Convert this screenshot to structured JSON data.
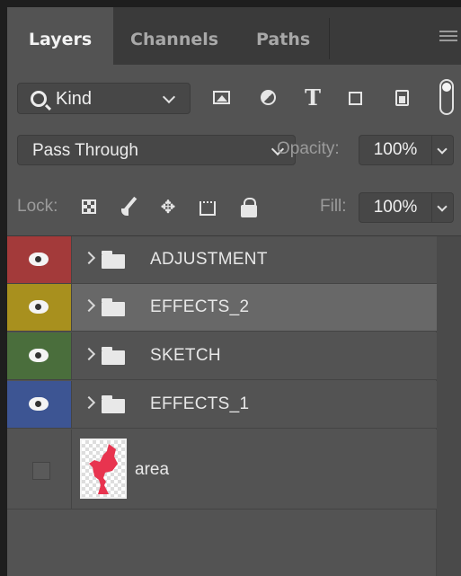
{
  "tabs": {
    "layers": "Layers",
    "channels": "Channels",
    "paths": "Paths"
  },
  "filter": {
    "kind_label": "Kind",
    "icons": [
      "image-filter-icon",
      "adjustment-filter-icon",
      "type-filter-icon",
      "shape-filter-icon",
      "smart-object-filter-icon"
    ],
    "type_glyph": "T"
  },
  "blend": {
    "mode": "Pass Through",
    "opacity_label": "Opacity:",
    "opacity_value": "100%"
  },
  "lock": {
    "label": "Lock:",
    "fill_label": "Fill:",
    "fill_value": "100%",
    "move_glyph": "✥"
  },
  "layers": [
    {
      "name": "ADJUSTMENT",
      "label_color": "#a33a3a",
      "visible": true,
      "type": "group",
      "selected": false
    },
    {
      "name": "EFFECTS_2",
      "label_color": "#a8901e",
      "visible": true,
      "type": "group",
      "selected": true
    },
    {
      "name": "SKETCH",
      "label_color": "#4a6e3c",
      "visible": true,
      "type": "group",
      "selected": false
    },
    {
      "name": "EFFECTS_1",
      "label_color": "#3d5593",
      "visible": true,
      "type": "group",
      "selected": false
    },
    {
      "name": "area",
      "label_color": "",
      "visible": false,
      "type": "pixel",
      "selected": false
    }
  ],
  "colors": {
    "panel_bg": "#535353",
    "tabbar_bg": "#3a3a3a",
    "selected_row": "#686868",
    "thumbnail_shape": "#e8344f"
  }
}
